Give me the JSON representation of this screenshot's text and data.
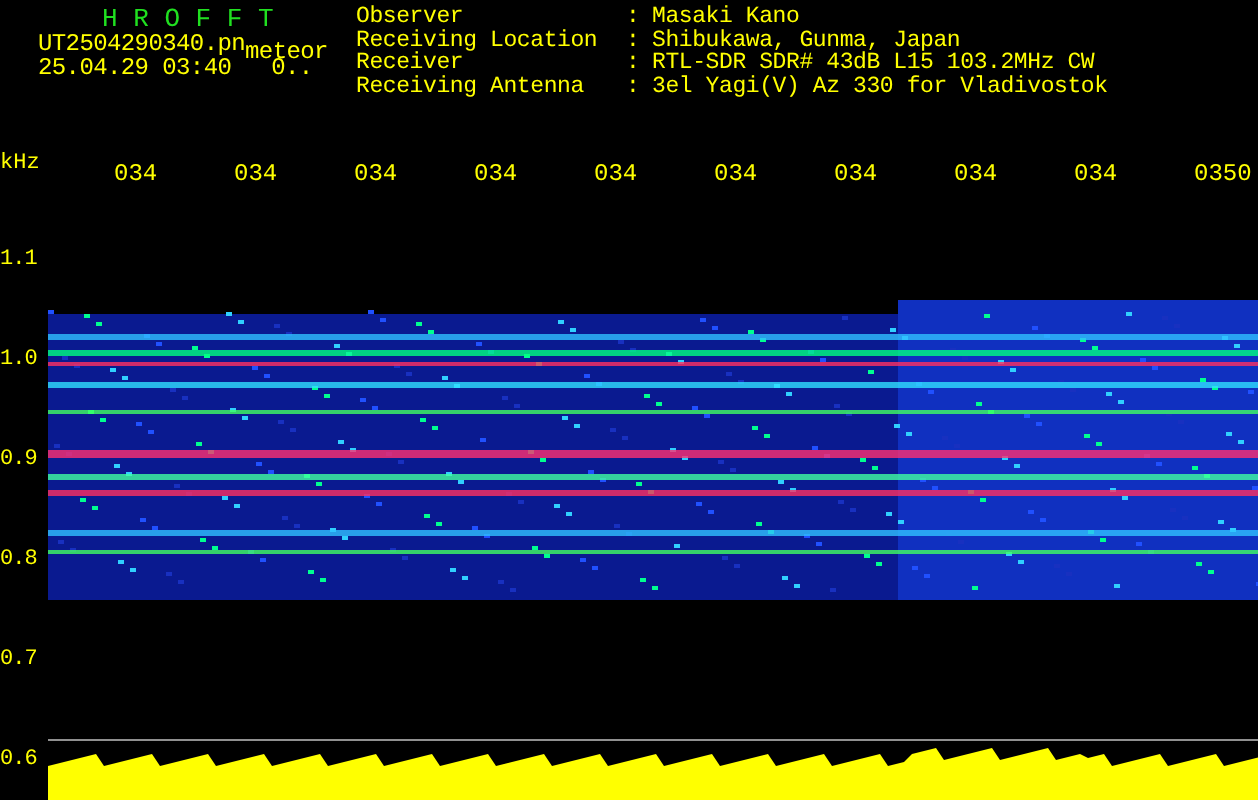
{
  "header": {
    "title": "H R O F F T",
    "filename": "UT2504290340.pn",
    "mode": "meteor",
    "datetime": "25.04.29 03:40",
    "counter": "0..",
    "info": [
      {
        "label": "Observer",
        "separator": ":",
        "value": "Masaki Kano"
      },
      {
        "label": "Receiving Location",
        "separator": ":",
        "value": "Shibukawa, Gunma, Japan"
      },
      {
        "label": "Receiver",
        "separator": ":",
        "value": "RTL-SDR SDR# 43dB L15 103.2MHz CW"
      },
      {
        "label": "Receiving Antenna",
        "separator": ":",
        "value": "3el Yagi(V) Az 330 for Vladivostok"
      }
    ]
  },
  "plot": {
    "unit": "kHz",
    "time_labels": [
      "034",
      "034",
      "034",
      "034",
      "034",
      "034",
      "034",
      "034",
      "034",
      "0350"
    ],
    "freq_labels": [
      "1.1",
      "1.0",
      "0.9",
      "0.8",
      "0.7",
      "0.6"
    ]
  }
}
